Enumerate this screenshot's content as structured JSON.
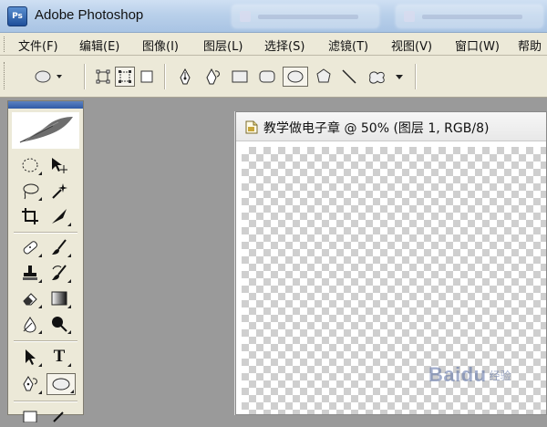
{
  "app": {
    "title": "Adobe Photoshop",
    "logo_text": "Ps"
  },
  "menu": [
    {
      "label": "文件(F)",
      "x": 0
    },
    {
      "label": "编辑(E)"
    },
    {
      "label": "图像(I)"
    },
    {
      "label": "图层(L)"
    },
    {
      "label": "选择(S)"
    },
    {
      "label": "滤镜(T)"
    },
    {
      "label": "视图(V)"
    },
    {
      "label": "窗口(W)"
    },
    {
      "label": "帮助"
    }
  ],
  "options_bar": {
    "tools": [
      "ellipse-preset",
      "shape-layers",
      "paths",
      "fill-pixels",
      "pen",
      "freeform-pen",
      "rectangle",
      "rounded-rectangle",
      "ellipse",
      "polygon",
      "line",
      "custom-shape"
    ],
    "selected": [
      "paths",
      "ellipse"
    ]
  },
  "toolbox": {
    "selected_tool": "ellipse-tool",
    "text_tool_glyph": "T"
  },
  "document": {
    "title": "教学做电子章 @ 50% (图层 1, RGB/8)"
  },
  "watermark": {
    "text": "Baidu",
    "sub": "经验"
  },
  "colors": {
    "titlebar": "#b9d0ea",
    "menubar": "#ece9d8",
    "workspace": "#9a9a9a",
    "accent": "#2f5aa6"
  }
}
